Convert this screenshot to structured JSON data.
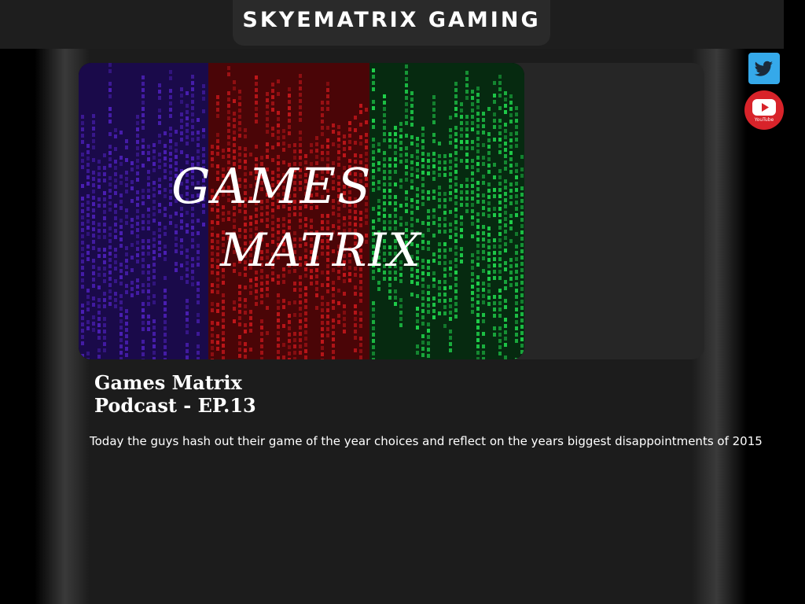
{
  "header": {
    "brand": "SKYEMATRIX GAMING"
  },
  "social": {
    "twitter_icon": "twitter-bird-icon",
    "youtube_icon": "youtube-play-icon",
    "youtube_caption": "YouTube"
  },
  "post": {
    "image_text_line1": "GAMES",
    "image_text_line2": "MATRIX",
    "title": "Games Matrix Podcast - EP.13",
    "description": "Today the guys hash out their game of the year choices and reflect on the years biggest disappointments of 2015"
  },
  "colors": {
    "background": "#000000",
    "column": "#1c1c1c",
    "header": "#1e1e1e",
    "twitter": "#35a9ea",
    "youtube": "#d8232a",
    "matrix_purple": "#4b1fb5",
    "matrix_red": "#c0161a",
    "matrix_green": "#1fcf4a"
  }
}
